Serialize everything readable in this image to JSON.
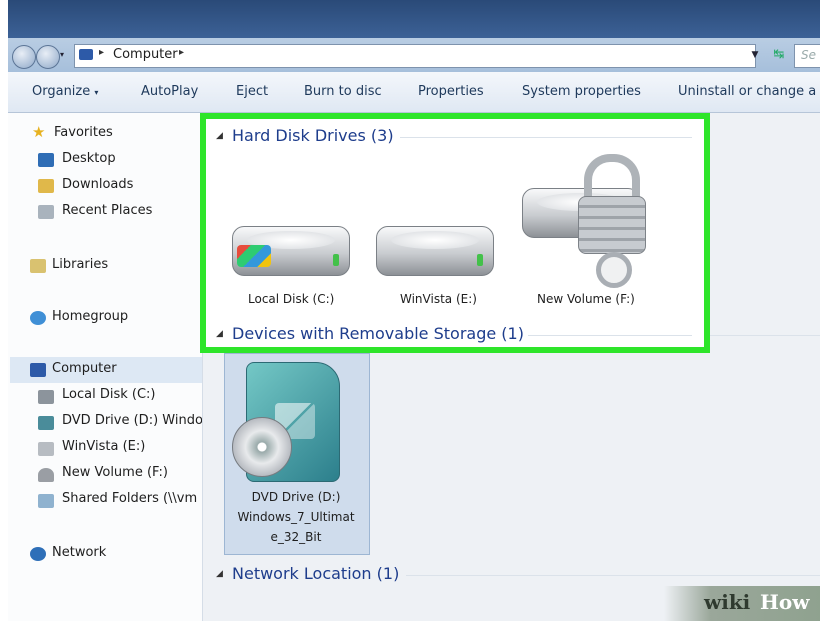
{
  "address": {
    "path": "Computer",
    "search_placeholder": "Se"
  },
  "toolbar": {
    "organize": "Organize",
    "autoplay": "AutoPlay",
    "eject": "Eject",
    "burn": "Burn to disc",
    "properties": "Properties",
    "system_properties": "System properties",
    "uninstall": "Uninstall or change a p"
  },
  "sidebar": {
    "favorites": "Favorites",
    "desktop": "Desktop",
    "downloads": "Downloads",
    "recent_places": "Recent Places",
    "libraries": "Libraries",
    "homegroup": "Homegroup",
    "computer": "Computer",
    "local_disk": "Local Disk (C:)",
    "dvd_drive": "DVD Drive (D:) Windo",
    "winvista": "WinVista (E:)",
    "new_volume": "New Volume (F:)",
    "shared_folders": "Shared Folders (\\\\vm",
    "network": "Network"
  },
  "groups": {
    "hard_disks": "Hard Disk Drives (3)",
    "removable": "Devices with Removable Storage (1)",
    "network_location": "Network Location (1)"
  },
  "drives": {
    "c": "Local Disk (C:)",
    "e": "WinVista (E:)",
    "f": "New Volume (F:)"
  },
  "dvd": {
    "line1": "DVD Drive (D:)",
    "line2": "Windows_7_Ultimat",
    "line3": "e_32_Bit"
  },
  "watermark": {
    "wiki": "wiki",
    "how": "How"
  },
  "colors": {
    "highlight": "#2ee52a",
    "group_heading": "#1e3d8c"
  }
}
